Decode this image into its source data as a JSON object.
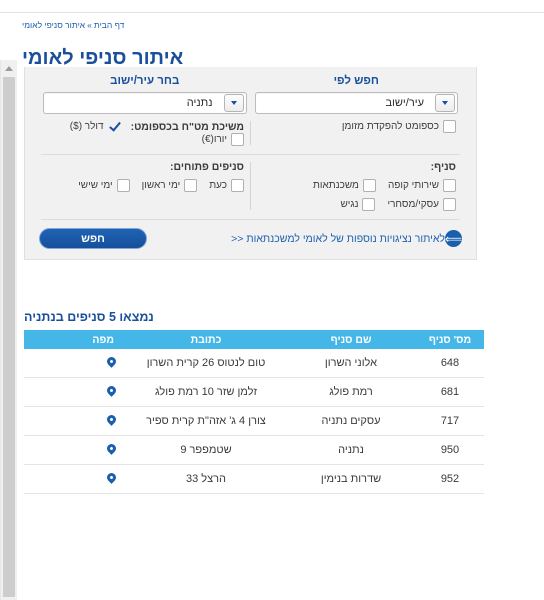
{
  "breadcrumb": {
    "home": "דף הבית",
    "separator": "»",
    "current": "איתור סניפי לאומי"
  },
  "page_title": "איתור סניפי לאומי",
  "search_panel": {
    "columns": [
      {
        "label": "חפש לפי",
        "field_name": "search-by-select",
        "value": "עיר/ישוב",
        "icon": "chevron-down-icon"
      },
      {
        "label": "בחר עיר/ישוב",
        "field_name": "city-select",
        "value": "נתניה",
        "icon": "chevron-down-icon"
      }
    ],
    "row_services": {
      "right_group": {
        "items": [
          {
            "label": "כספומט להפקדת מזומן",
            "checked": false
          }
        ]
      },
      "left_group": {
        "title": "משיכת מט\"ח בכספומט:",
        "items": [
          {
            "label": "דולר ($)",
            "checked": true
          },
          {
            "label": "יורו(€)",
            "checked": false
          }
        ]
      }
    },
    "row_branch": {
      "right_group": {
        "title": "סניף:",
        "line1": [
          {
            "label": "שירותי קופה",
            "checked": false
          },
          {
            "label": "משכנתאות",
            "checked": false
          }
        ],
        "line2": [
          {
            "label": "עסקי/מסחרי",
            "checked": false
          },
          {
            "label": "נגיש",
            "checked": false
          }
        ]
      },
      "left_group": {
        "title": "סניפים פתוחים:",
        "items": [
          {
            "label": "כעת",
            "checked": false
          },
          {
            "label": "ימי ראשון",
            "checked": false
          },
          {
            "label": "ימי שישי",
            "checked": false
          }
        ]
      }
    },
    "actions": {
      "search_button": "חפש",
      "mortgage_link": "לאיתור נציגויות נוספות של לאומי למשכנתאות <<",
      "link_icon": "circle-arrow-left-icon"
    }
  },
  "results": {
    "title": "נמצאו 5 סניפים בנתניה",
    "columns": [
      "מס' סניף",
      "שם סניף",
      "כתובת",
      "מפה"
    ],
    "rows": [
      {
        "num": "648",
        "name": "אלוני השרון",
        "address": "טום לנטוס 26 קרית השרון",
        "map": "map-pin-icon"
      },
      {
        "num": "681",
        "name": "רמת פולג",
        "address": "זלמן שזר 10 רמת פולג",
        "map": "map-pin-icon"
      },
      {
        "num": "717",
        "name": "עסקים נתניה",
        "address": "צורן 4 ג' אזה\"ת קרית ספיר",
        "map": "map-pin-icon"
      },
      {
        "num": "950",
        "name": "נתניה",
        "address": "שטמפפר 9",
        "map": "map-pin-icon"
      },
      {
        "num": "952",
        "name": "שדרות בנימין",
        "address": "הרצל 33",
        "map": "map-pin-icon"
      }
    ]
  },
  "colors": {
    "brand_blue": "#1a4f9c",
    "link_blue": "#2060ae",
    "table_header": "#45b6e8",
    "panel_bg": "#f1f1f1"
  }
}
